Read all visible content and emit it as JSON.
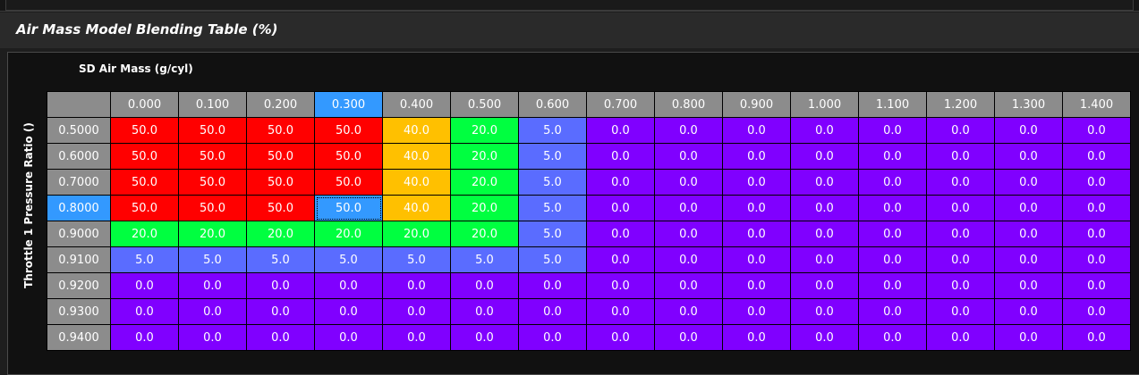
{
  "title": "Air Mass Model Blending Table (%)",
  "x_axis_label": "SD Air Mass (g/cyl)",
  "y_axis_label": "Throttle 1 Pressure Ratio ()",
  "colors": {
    "v50": "#ff0000",
    "v40": "#ffc000",
    "v20": "#00ff40",
    "v5": "#5a6cff",
    "v0": "#8000ff",
    "selected": "#3399ff"
  },
  "selected_col": "0.300",
  "selected_row": "0.8000",
  "columns": [
    "0.000",
    "0.100",
    "0.200",
    "0.300",
    "0.400",
    "0.500",
    "0.600",
    "0.700",
    "0.800",
    "0.900",
    "1.000",
    "1.100",
    "1.200",
    "1.300",
    "1.400"
  ],
  "rows": [
    {
      "label": "0.5000",
      "values": [
        "50.0",
        "50.0",
        "50.0",
        "50.0",
        "40.0",
        "20.0",
        "5.0",
        "0.0",
        "0.0",
        "0.0",
        "0.0",
        "0.0",
        "0.0",
        "0.0",
        "0.0"
      ]
    },
    {
      "label": "0.6000",
      "values": [
        "50.0",
        "50.0",
        "50.0",
        "50.0",
        "40.0",
        "20.0",
        "5.0",
        "0.0",
        "0.0",
        "0.0",
        "0.0",
        "0.0",
        "0.0",
        "0.0",
        "0.0"
      ]
    },
    {
      "label": "0.7000",
      "values": [
        "50.0",
        "50.0",
        "50.0",
        "50.0",
        "40.0",
        "20.0",
        "5.0",
        "0.0",
        "0.0",
        "0.0",
        "0.0",
        "0.0",
        "0.0",
        "0.0",
        "0.0"
      ]
    },
    {
      "label": "0.8000",
      "values": [
        "50.0",
        "50.0",
        "50.0",
        "50.0",
        "40.0",
        "20.0",
        "5.0",
        "0.0",
        "0.0",
        "0.0",
        "0.0",
        "0.0",
        "0.0",
        "0.0",
        "0.0"
      ]
    },
    {
      "label": "0.9000",
      "values": [
        "20.0",
        "20.0",
        "20.0",
        "20.0",
        "20.0",
        "20.0",
        "5.0",
        "0.0",
        "0.0",
        "0.0",
        "0.0",
        "0.0",
        "0.0",
        "0.0",
        "0.0"
      ]
    },
    {
      "label": "0.9100",
      "values": [
        "5.0",
        "5.0",
        "5.0",
        "5.0",
        "5.0",
        "5.0",
        "5.0",
        "0.0",
        "0.0",
        "0.0",
        "0.0",
        "0.0",
        "0.0",
        "0.0",
        "0.0"
      ]
    },
    {
      "label": "0.9200",
      "values": [
        "0.0",
        "0.0",
        "0.0",
        "0.0",
        "0.0",
        "0.0",
        "0.0",
        "0.0",
        "0.0",
        "0.0",
        "0.0",
        "0.0",
        "0.0",
        "0.0",
        "0.0"
      ]
    },
    {
      "label": "0.9300",
      "values": [
        "0.0",
        "0.0",
        "0.0",
        "0.0",
        "0.0",
        "0.0",
        "0.0",
        "0.0",
        "0.0",
        "0.0",
        "0.0",
        "0.0",
        "0.0",
        "0.0",
        "0.0"
      ]
    },
    {
      "label": "0.9400",
      "values": [
        "0.0",
        "0.0",
        "0.0",
        "0.0",
        "0.0",
        "0.0",
        "0.0",
        "0.0",
        "0.0",
        "0.0",
        "0.0",
        "0.0",
        "0.0",
        "0.0",
        "0.0"
      ]
    }
  ]
}
